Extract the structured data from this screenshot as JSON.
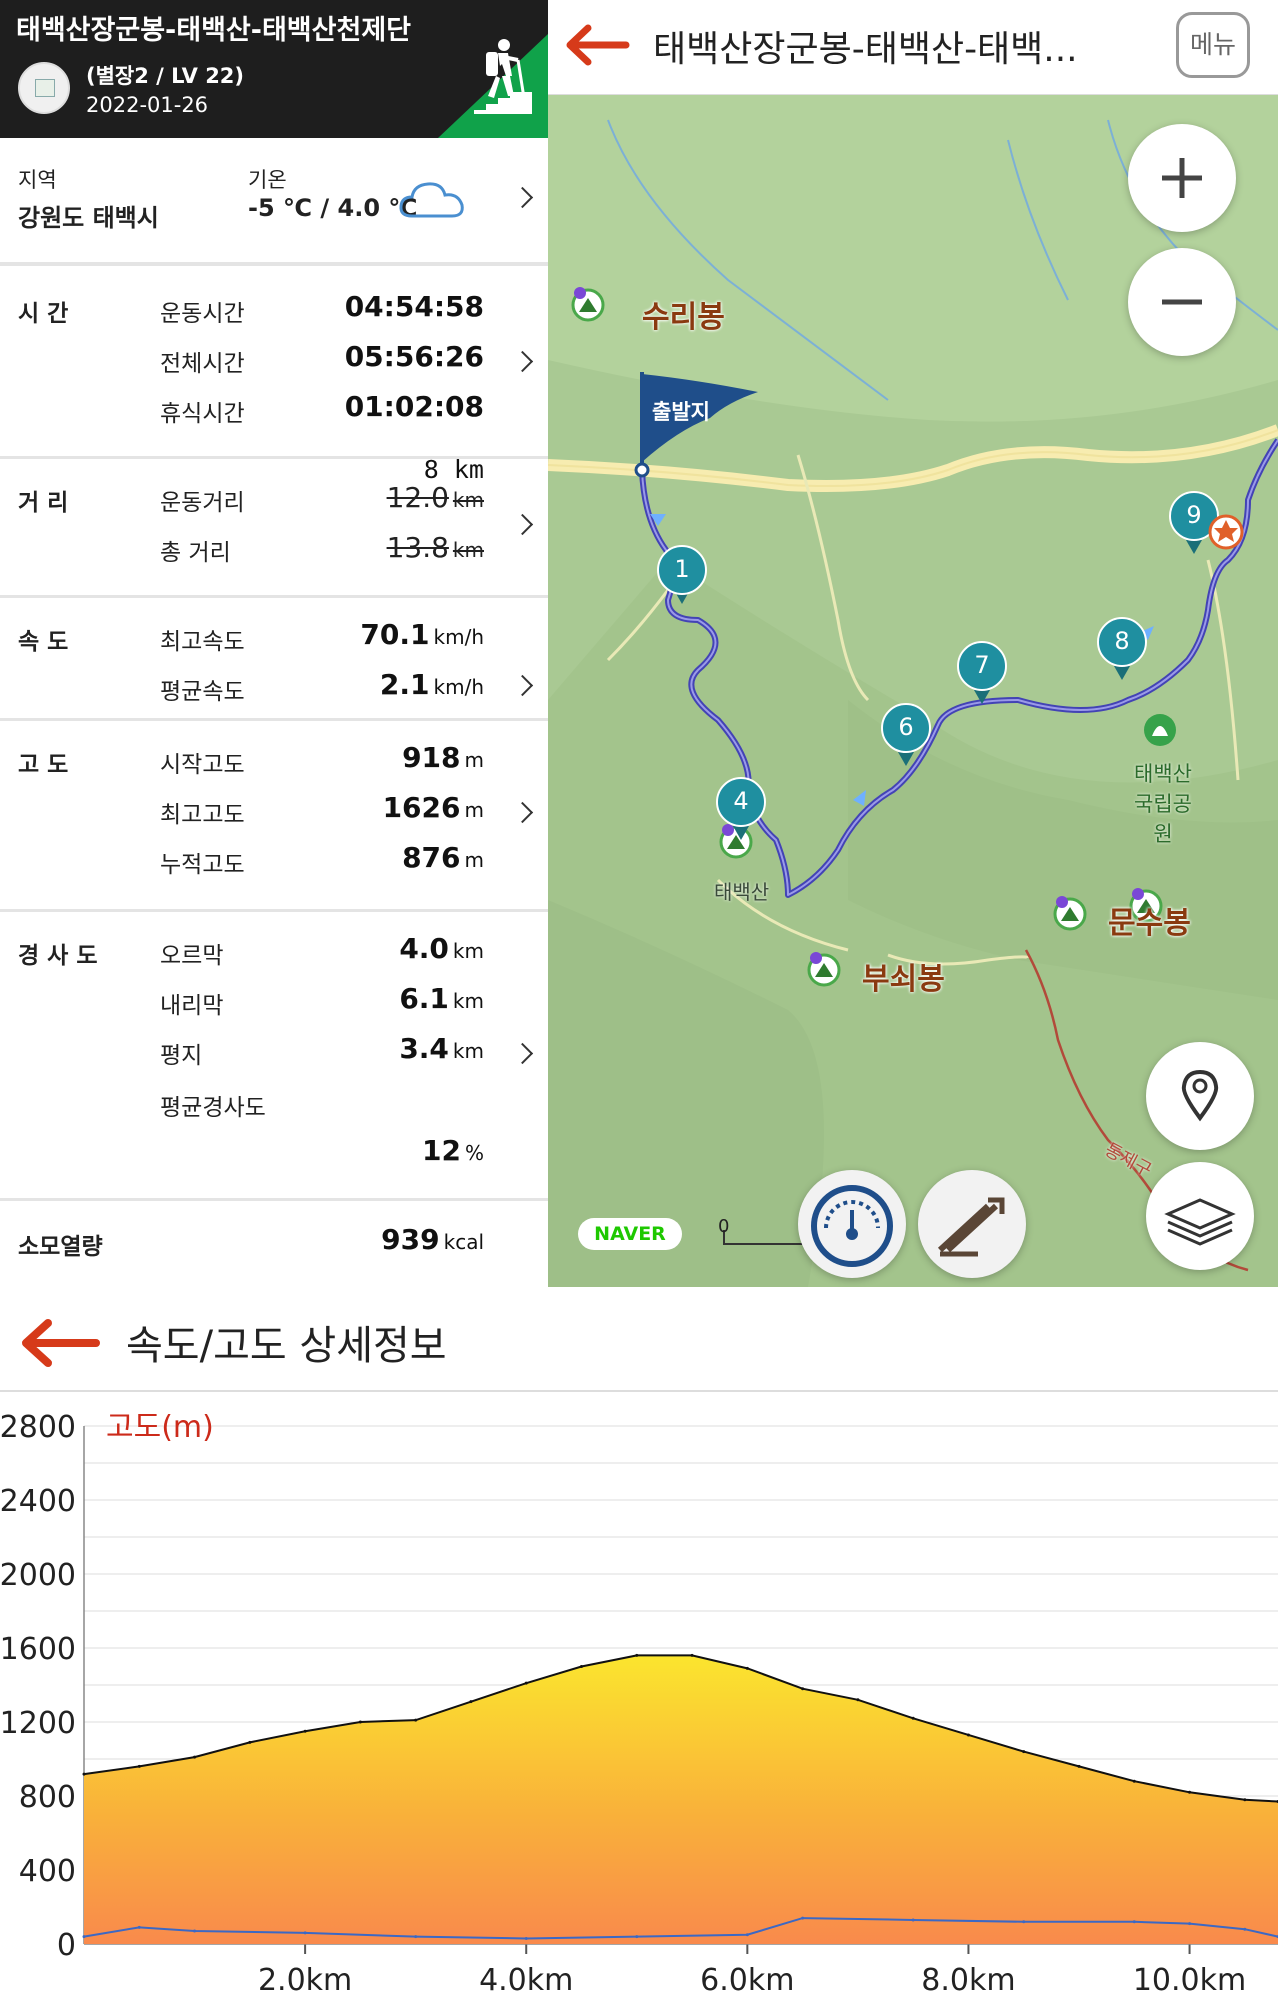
{
  "header": {
    "title": "태백산장군봉-태백산-태백산천제단",
    "user": "(별장2 / LV 22)",
    "date": "2022-01-26"
  },
  "info": {
    "region_label": "지역",
    "region_value": "강원도 태백시",
    "temp_label": "기온",
    "temp_value": "-5 ℃ / 4.0 ℃"
  },
  "time": {
    "label": "시    간",
    "rows": [
      {
        "label": "운동시간",
        "value": "04:54:58"
      },
      {
        "label": "전체시간",
        "value": "05:56:26"
      },
      {
        "label": "휴식시간",
        "value": "01:02:08"
      }
    ]
  },
  "distance": {
    "label": "거    리",
    "note": "8 km",
    "rows": [
      {
        "label": "운동거리",
        "value": "12.0",
        "unit": "km"
      },
      {
        "label": "총 거리",
        "value": "13.8",
        "unit": "km"
      }
    ]
  },
  "speed": {
    "label": "속    도",
    "rows": [
      {
        "label": "최고속도",
        "value": "70.1",
        "unit": "km/h"
      },
      {
        "label": "평균속도",
        "value": "2.1",
        "unit": "km/h"
      }
    ]
  },
  "altitude": {
    "label": "고    도",
    "rows": [
      {
        "label": "시작고도",
        "value": "918",
        "unit": "m"
      },
      {
        "label": "최고고도",
        "value": "1626",
        "unit": "m"
      },
      {
        "label": "누적고도",
        "value": "876",
        "unit": "m"
      }
    ]
  },
  "slope": {
    "label": "경 사 도",
    "rows": [
      {
        "label": "오르막",
        "value": "4.0",
        "unit": "km"
      },
      {
        "label": "내리막",
        "value": "6.1",
        "unit": "km"
      },
      {
        "label": "평지",
        "value": "3.4",
        "unit": "km"
      },
      {
        "label": "평균경사도",
        "value": "12",
        "unit": "%"
      }
    ]
  },
  "calories": {
    "label": "소모열량",
    "value": "939",
    "unit": "kcal"
  },
  "map": {
    "title": "태백산장군봉-태백산-태백...",
    "menu_label": "메뉴",
    "start_label": "출발지",
    "peaks": [
      "수리봉",
      "부쇠봉",
      "문수봉"
    ],
    "park_label_1": "태백산",
    "park_label_2": "국립공원",
    "partial_label_1": "태백산",
    "partial_label_2": "통제구",
    "waypoints": [
      "1",
      "4",
      "6",
      "7",
      "8",
      "9"
    ],
    "naver": "NAVER",
    "scale_zero": "0"
  },
  "section_title": "속도/고도 상세정보",
  "chart_data": {
    "type": "area",
    "series": [
      {
        "name": "고도(m)",
        "x": [
          0,
          0.5,
          1.0,
          1.5,
          2.0,
          2.5,
          3.0,
          3.5,
          4.0,
          4.5,
          5.0,
          5.5,
          6.0,
          6.5,
          7.0,
          7.5,
          8.0,
          8.5,
          9.0,
          9.5,
          10.0,
          10.5,
          10.8
        ],
        "values": [
          918,
          960,
          1010,
          1090,
          1150,
          1200,
          1210,
          1310,
          1410,
          1500,
          1560,
          1560,
          1490,
          1380,
          1320,
          1220,
          1130,
          1040,
          960,
          880,
          820,
          780,
          770
        ]
      },
      {
        "name": "속도",
        "x": [
          0,
          0.5,
          1.0,
          2.0,
          3.0,
          4.0,
          5.0,
          6.0,
          6.5,
          7.5,
          8.5,
          9.5,
          10.0,
          10.5,
          10.8
        ],
        "values": [
          40,
          90,
          70,
          60,
          40,
          30,
          40,
          50,
          140,
          130,
          120,
          120,
          110,
          80,
          40
        ]
      }
    ],
    "xlabel": "",
    "ylabel": "",
    "y_ticks": [
      "2800",
      "2400",
      "2000",
      "1600",
      "1200",
      "800",
      "400",
      "0"
    ],
    "x_ticks": [
      "2.0km",
      "4.0km",
      "6.0km",
      "8.0km",
      "10.0km"
    ],
    "ylim": [
      0,
      2800
    ],
    "xlim": [
      0,
      10.8
    ],
    "grid": true
  },
  "colors": {
    "accent": "#10a24a",
    "route": "#4343b5",
    "waypoint": "#1f8fa0",
    "flag": "#1f4e8a",
    "arrow": "#d63a1a",
    "peak_text": "#8a3a10",
    "label_red": "#cc2a1a"
  }
}
